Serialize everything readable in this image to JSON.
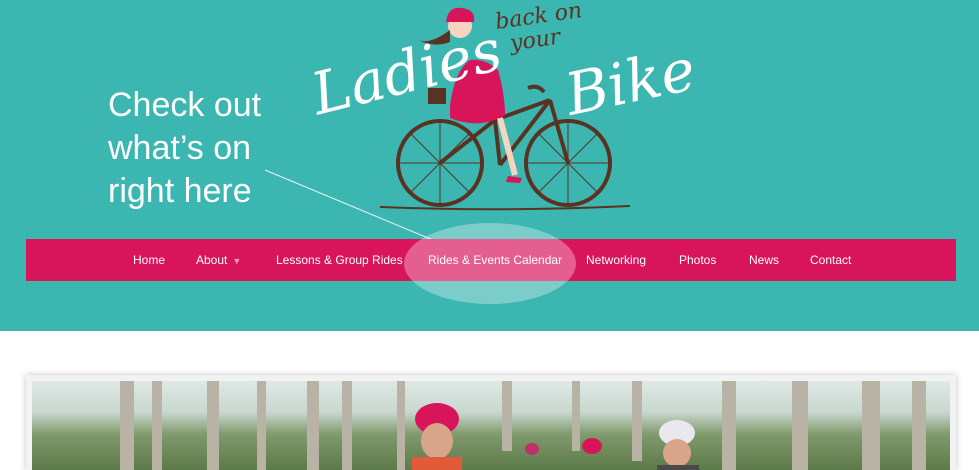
{
  "logo": {
    "word_1": "Ladies",
    "word_2": "back on",
    "word_3": "your",
    "word_4": "Bike"
  },
  "callout": {
    "line_1": "Check out",
    "line_2": "what’s on",
    "line_3": "right here"
  },
  "nav": {
    "items": [
      {
        "label": "Home"
      },
      {
        "label": "About"
      },
      {
        "label": "Lessons & Group Rides"
      },
      {
        "label": "Rides & Events Calendar"
      },
      {
        "label": "Networking"
      },
      {
        "label": "Photos"
      },
      {
        "label": "News"
      },
      {
        "label": "Contact"
      }
    ],
    "about_caret": "▼"
  },
  "colors": {
    "header_bg": "#3bb6b0",
    "nav_bg": "#d8145a",
    "accent_brown": "#5a3221"
  }
}
